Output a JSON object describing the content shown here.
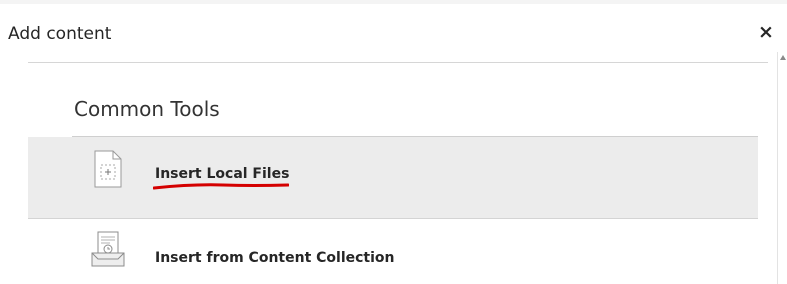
{
  "dialog": {
    "title": "Add content",
    "close_symbol": "×"
  },
  "section": {
    "heading": "Common Tools"
  },
  "tools": [
    {
      "label": "Insert Local Files",
      "icon": "insert-file-icon",
      "selected": true
    },
    {
      "label": "Insert from Content Collection",
      "icon": "content-collection-icon",
      "selected": false
    }
  ],
  "annotation": {
    "underline_color": "#d40000"
  }
}
